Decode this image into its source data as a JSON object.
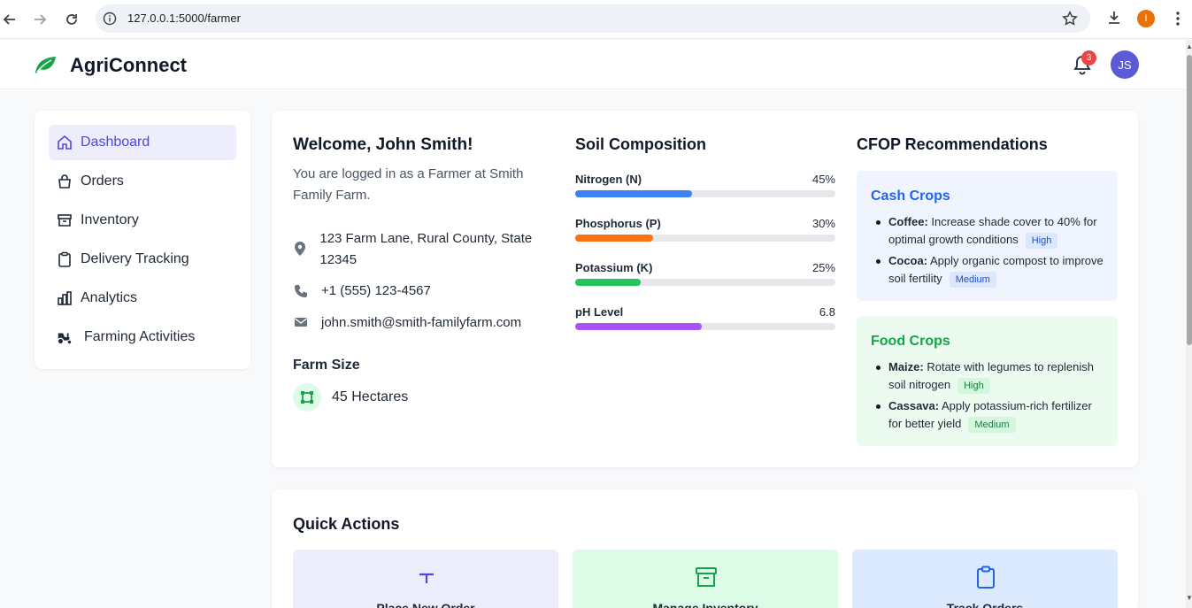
{
  "browser": {
    "url": "127.0.0.1:5000/farmer",
    "profile_initial": "I"
  },
  "header": {
    "brand": "AgriConnect",
    "notification_count": "3",
    "avatar_initials": "JS"
  },
  "sidebar": {
    "items": [
      {
        "label": "Dashboard",
        "icon": "home-icon",
        "active": true
      },
      {
        "label": "Orders",
        "icon": "shopping-bag-icon"
      },
      {
        "label": "Inventory",
        "icon": "archive-box-icon"
      },
      {
        "label": "Delivery Tracking",
        "icon": "clipboard-icon"
      },
      {
        "label": "Analytics",
        "icon": "bar-chart-icon"
      },
      {
        "label": "Farming Activities",
        "icon": "tractor-icon"
      }
    ]
  },
  "welcome": {
    "title": "Welcome, John Smith!",
    "subtitle": "You are logged in as a Farmer at Smith Family Farm.",
    "address": "123 Farm Lane, Rural County, State 12345",
    "phone": "+1 (555) 123-4567",
    "email": "john.smith@smith-familyfarm.com",
    "farm_size_label": "Farm Size",
    "farm_size_value": "45 Hectares"
  },
  "soil": {
    "title": "Soil Composition",
    "rows": [
      {
        "label": "Nitrogen (N)",
        "value": "45%",
        "fraction": 0.45,
        "color": "#3b82f6"
      },
      {
        "label": "Phosphorus (P)",
        "value": "30%",
        "fraction": 0.3,
        "color": "#f97316"
      },
      {
        "label": "Potassium (K)",
        "value": "25%",
        "fraction": 0.25,
        "color": "#22c55e"
      },
      {
        "label": "pH Level",
        "value": "6.8",
        "fraction": 0.486,
        "color": "#a855f7"
      }
    ]
  },
  "cfop": {
    "title": "CFOP Recommendations",
    "cash": {
      "heading": "Cash Crops",
      "items": [
        {
          "crop": "Coffee:",
          "text": " Increase shade cover to 40% for optimal growth conditions",
          "priority": "High"
        },
        {
          "crop": "Cocoa:",
          "text": " Apply organic compost to improve soil fertility",
          "priority": "Medium"
        }
      ]
    },
    "food": {
      "heading": "Food Crops",
      "items": [
        {
          "crop": "Maize:",
          "text": " Rotate with legumes to replenish soil nitrogen",
          "priority": "High"
        },
        {
          "crop": "Cassava:",
          "text": " Apply potassium-rich fertilizer for better yield",
          "priority": "Medium"
        }
      ]
    }
  },
  "quick_actions": {
    "title": "Quick Actions",
    "items": [
      {
        "label": "Place New Order",
        "icon": "plus-icon"
      },
      {
        "label": "Manage Inventory",
        "icon": "archive-box-icon"
      },
      {
        "label": "Track Orders",
        "icon": "clipboard-icon"
      }
    ]
  },
  "colors": {
    "accent": "#4f46e5",
    "brand_green": "#16a34a"
  }
}
